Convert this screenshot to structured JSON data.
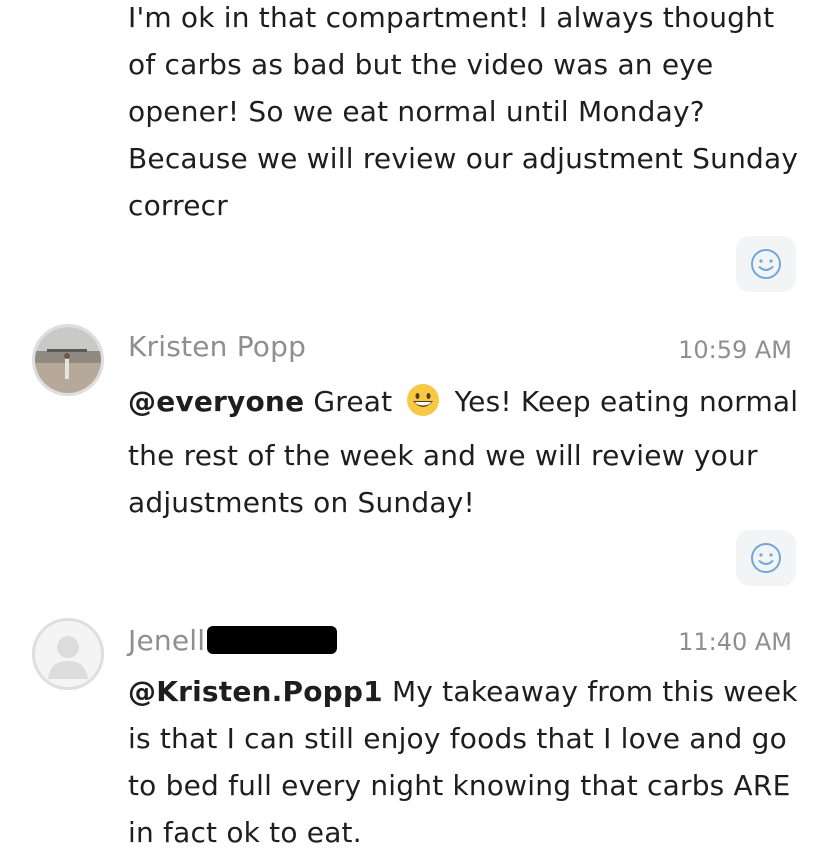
{
  "messages": [
    {
      "text": "I'm ok in that compartment! I always thought of carbs as bad but the video was an eye opener! So we eat normal until Monday? Because we will review our adjustment Sunday correcr",
      "reaction_icon": "smiley-add-reaction-icon"
    },
    {
      "author": "Kristen Popp",
      "time": "10:59 AM",
      "avatar_icon": "beach-photo-avatar",
      "mention": "@everyone",
      "text_before_emoji": "Great",
      "emoji": "grinning-face-emoji",
      "text_after_emoji": "Yes! Keep eating normal the rest of the week and we will review your adjustments on Sunday!",
      "reaction_icon": "smiley-add-reaction-icon"
    },
    {
      "author": "Jenell",
      "time": "11:40 AM",
      "avatar_icon": "default-user-avatar",
      "mention": "@Kristen.Popp1",
      "text": "My takeaway from this week is that I can still enjoy foods that I love and go to bed full every night knowing that carbs ARE in fact ok to eat."
    }
  ],
  "colors": {
    "text": "#1e1e1e",
    "meta": "#8f8f8f",
    "reaction_bg": "#f3f4f6",
    "reaction_icon": "#6fa8dc"
  }
}
